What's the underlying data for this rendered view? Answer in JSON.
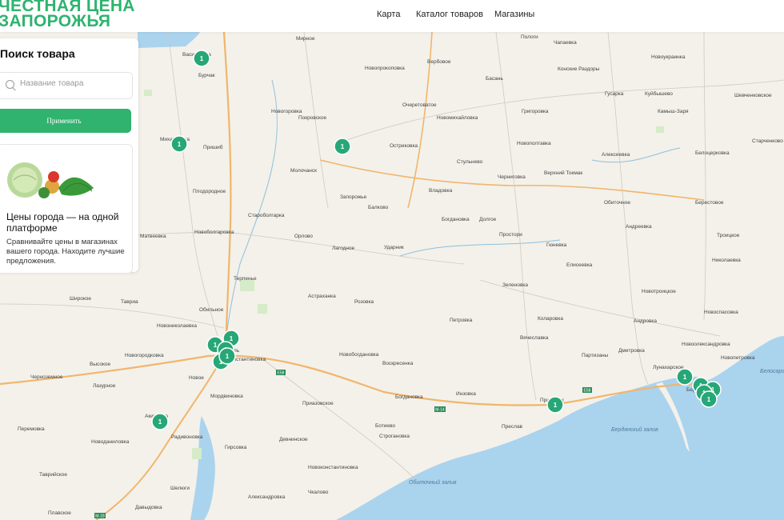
{
  "brand": {
    "line1": "ЧЕСТНАЯ ЦЕНА",
    "line2": "ЗАПОРОЖЬЯ",
    "color": "#2fb36f"
  },
  "nav": {
    "items": [
      "Карта",
      "Каталог товаров",
      "Магазины"
    ]
  },
  "search_panel": {
    "title": "Поиск товара",
    "placeholder": "Название товара",
    "apply_label": "Применить"
  },
  "promo": {
    "title": "Цены города — на одной платформе",
    "text": "Сравнивайте цены в магазинах вашего города. Находите лучшие предложения."
  },
  "map": {
    "places": [
      "Мирное",
      "Васильевка",
      "Бурчак",
      "Пологи",
      "Чапаевка",
      "Новоукраинка",
      "Вербовое",
      "Новопрокоповка",
      "Конские Раздоры",
      "Басань",
      "Гусарка",
      "Куйбышево",
      "Шевченковское",
      "Очеретоватое",
      "Новомихайловка",
      "Григоровка",
      "Камыш-Заря",
      "Новогоровка",
      "Покровское",
      "Михайловка",
      "Пришиб",
      "Остриковка",
      "Новополтавка",
      "Старченково",
      "Стульнево",
      "Алексеевка",
      "Белоцерковка",
      "Молочанск",
      "Черниговка",
      "Верхний Токмак",
      "Плодородное",
      "Запорожье",
      "Владовка",
      "Обиточное",
      "Берестовое",
      "Староболгарка",
      "Балково",
      "Богдановка",
      "Долгое",
      "Новоболгаровка",
      "Орлово",
      "Андреевка",
      "Троицкое",
      "Простори",
      "Матвеевка",
      "Лагодное",
      "Ударник",
      "Гюневка",
      "Елисеевка",
      "Николаевка",
      "Терпенье",
      "Зеленовка",
      "Новотроицкое",
      "Широкое",
      "Тавриа",
      "Астраханка",
      "Розовка",
      "Обильное",
      "Андровка",
      "Новониколаевка",
      "Петровка",
      "Коларовка",
      "Новоспасовка",
      "Вячеславка",
      "Новогородковка",
      "Новоолександровка",
      "Партизаны",
      "Дмитровка",
      "Новопетровка",
      "Высокое",
      "Новое",
      "Новобогдановка",
      "Воскресенка",
      "Лунахарское",
      "Мелитополь",
      "Константиновка",
      "Черноземное",
      "Лазурное",
      "Мордвиновка",
      "Богдановка",
      "Инзовка",
      "Бердянск",
      "Приазовское",
      "Приморск",
      "Перемовка",
      "Радивоновка",
      "Ботиево",
      "Преслав",
      "Строгановка",
      "Новоданиловка",
      "Гирсовка",
      "Девнинское",
      "Таврийское",
      "Новоконстантиновка",
      "Шелюги",
      "Чкалово",
      "Александровка",
      "Давыдовка",
      "Плавское",
      "Акимовка"
    ],
    "water": [
      "Бердянский залив",
      "Обиточный залив",
      "Белосарайская"
    ],
    "road_labels": [
      "E58",
      "M-14",
      "E58",
      "M-18"
    ],
    "markers": [
      {
        "label": "1"
      },
      {
        "label": "1"
      },
      {
        "label": "1"
      },
      {
        "label": "1"
      },
      {
        "label": "1"
      },
      {
        "label": "1"
      },
      {
        "label": "1"
      },
      {
        "label": "1"
      },
      {
        "label": "1"
      },
      {
        "label": "1"
      },
      {
        "label": "1"
      },
      {
        "label": "1"
      },
      {
        "label": "1"
      },
      {
        "label": "1"
      },
      {
        "label": "1"
      }
    ],
    "colors": {
      "land": "#f3f1ea",
      "sea": "#aad3ee",
      "marker": "#27a777",
      "road_major": "#f2b56b"
    }
  }
}
